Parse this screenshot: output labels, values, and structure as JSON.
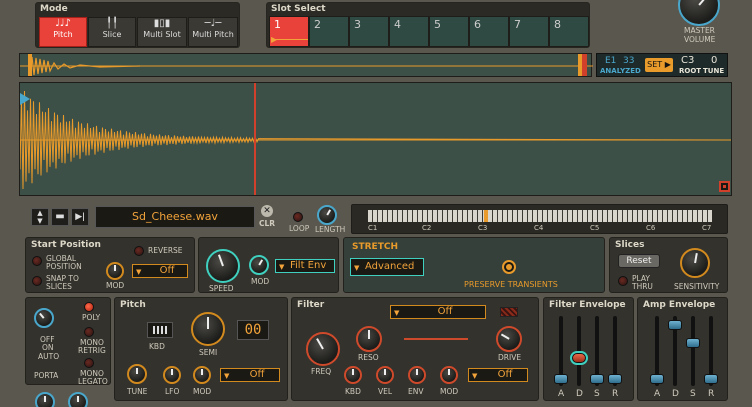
{
  "mode": {
    "title": "Mode",
    "buttons": [
      {
        "label": "Pitch",
        "active": true
      },
      {
        "label": "Slice",
        "active": false
      },
      {
        "label": "Multi Slot",
        "active": false
      },
      {
        "label": "Multi Pitch",
        "active": false
      }
    ]
  },
  "slot_select": {
    "title": "Slot Select",
    "slots": [
      "1",
      "2",
      "3",
      "4",
      "5",
      "6",
      "7",
      "8"
    ],
    "active_slot": "1"
  },
  "master": {
    "label_line1": "MASTER",
    "label_line2": "VOLUME"
  },
  "overview": {
    "e_label": "E1",
    "count": "33",
    "analyzed": "ANALYZED",
    "set_button": "SET ▶",
    "root_note": "C3",
    "root_label": "ROOT",
    "tune_value": "0",
    "tune_label": "TUNE"
  },
  "file": {
    "name": "Sd_Cheese.wav",
    "clear_label": "CLR",
    "loop_label": "LOOP",
    "length_label": "LENGTH"
  },
  "keyboard": {
    "octave_labels": [
      "C1",
      "C2",
      "C3",
      "C4",
      "C5",
      "C6",
      "C7"
    ]
  },
  "start_position": {
    "title": "Start Position",
    "global_position": [
      "GLOBAL",
      "POSITION"
    ],
    "snap_to_slices": [
      "SNAP TO",
      "SLICES"
    ],
    "reverse": "REVERSE",
    "mod": "MOD",
    "dropdown": "Off"
  },
  "speed": {
    "speed_label": "SPEED",
    "mod_label": "MOD",
    "dropdown": "Filt Env"
  },
  "stretch": {
    "title": "STRETCH",
    "mode_dropdown": "Advanced",
    "preserve": "PRESERVE TRANSIENTS"
  },
  "slices": {
    "title": "Slices",
    "reset": "Reset",
    "play_thru": [
      "PLAY",
      "THRU"
    ],
    "sensitivity": "SENSITIVITY"
  },
  "voice": {
    "poly": "POLY",
    "off_on_auto": [
      "OFF",
      "ON",
      "AUTO"
    ],
    "mono_retrig": [
      "MONO",
      "RETRIG"
    ],
    "mono_legato": [
      "MONO",
      "LEGATO"
    ],
    "porta": "PORTA"
  },
  "pitch": {
    "title": "Pitch",
    "kbd": "KBD",
    "semi": "SEMI",
    "semi_value": "00",
    "tune": "TUNE",
    "lfo": "LFO",
    "mod": "MOD",
    "dropdown": "Off"
  },
  "filter": {
    "title": "Filter",
    "type_dropdown": "Off",
    "freq": "FREQ",
    "reso": "RESO",
    "drive": "DRIVE",
    "kbd": "KBD",
    "vel": "VEL",
    "env": "ENV",
    "mod": "MOD",
    "mod_dropdown": "Off"
  },
  "filter_envelope": {
    "title": "Filter Envelope",
    "labels": [
      "A",
      "D",
      "S",
      "R"
    ]
  },
  "amp_envelope": {
    "title": "Amp Envelope",
    "labels": [
      "A",
      "D",
      "S",
      "R"
    ]
  },
  "colors": {
    "accent": "#d28a1e",
    "active_red": "#e8423a",
    "cyan": "#3fd0bf",
    "waveform": "#e89a2a"
  }
}
